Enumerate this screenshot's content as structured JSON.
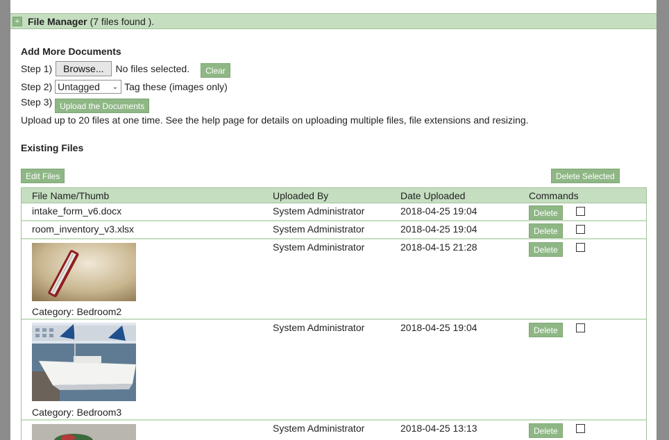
{
  "file_manager": {
    "title": "File Manager",
    "count_text": "(7 files found ).",
    "toggle": "+"
  },
  "upload": {
    "heading": "Add More Documents",
    "step1_label": "Step 1)",
    "browse_label": "Browse...",
    "no_files": "No files selected.",
    "clear_label": "Clear",
    "step2_label": "Step 2)",
    "tag_value": "Untagged",
    "tag_hint": "Tag these (images only)",
    "step3_label": "Step 3)",
    "upload_label": "Upload the Documents",
    "help_text": "Upload up to 20 files at one time. See the help page for details on uploading multiple files, file extensions and resizing."
  },
  "existing": {
    "heading": "Existing Files",
    "edit_label": "Edit Files",
    "delete_selected_label": "Delete Selected",
    "columns": [
      "File Name/Thumb",
      "Uploaded By",
      "Date Uploaded",
      "Commands"
    ],
    "delete_label": "Delete",
    "rows": [
      {
        "name": "intake_form_v6.docx",
        "by": "System Administrator",
        "date": "2018-04-25 19:04"
      },
      {
        "name": "room_inventory_v3.xlsx",
        "by": "System Administrator",
        "date": "2018-04-25 19:04"
      },
      {
        "category": "Category: Bedroom2",
        "by": "System Administrator",
        "date": "2018-04-15 21:28"
      },
      {
        "category": "Category: Bedroom3",
        "by": "System Administrator",
        "date": "2018-04-25 19:04"
      },
      {
        "by": "System Administrator",
        "date": "2018-04-25 13:13"
      }
    ]
  }
}
